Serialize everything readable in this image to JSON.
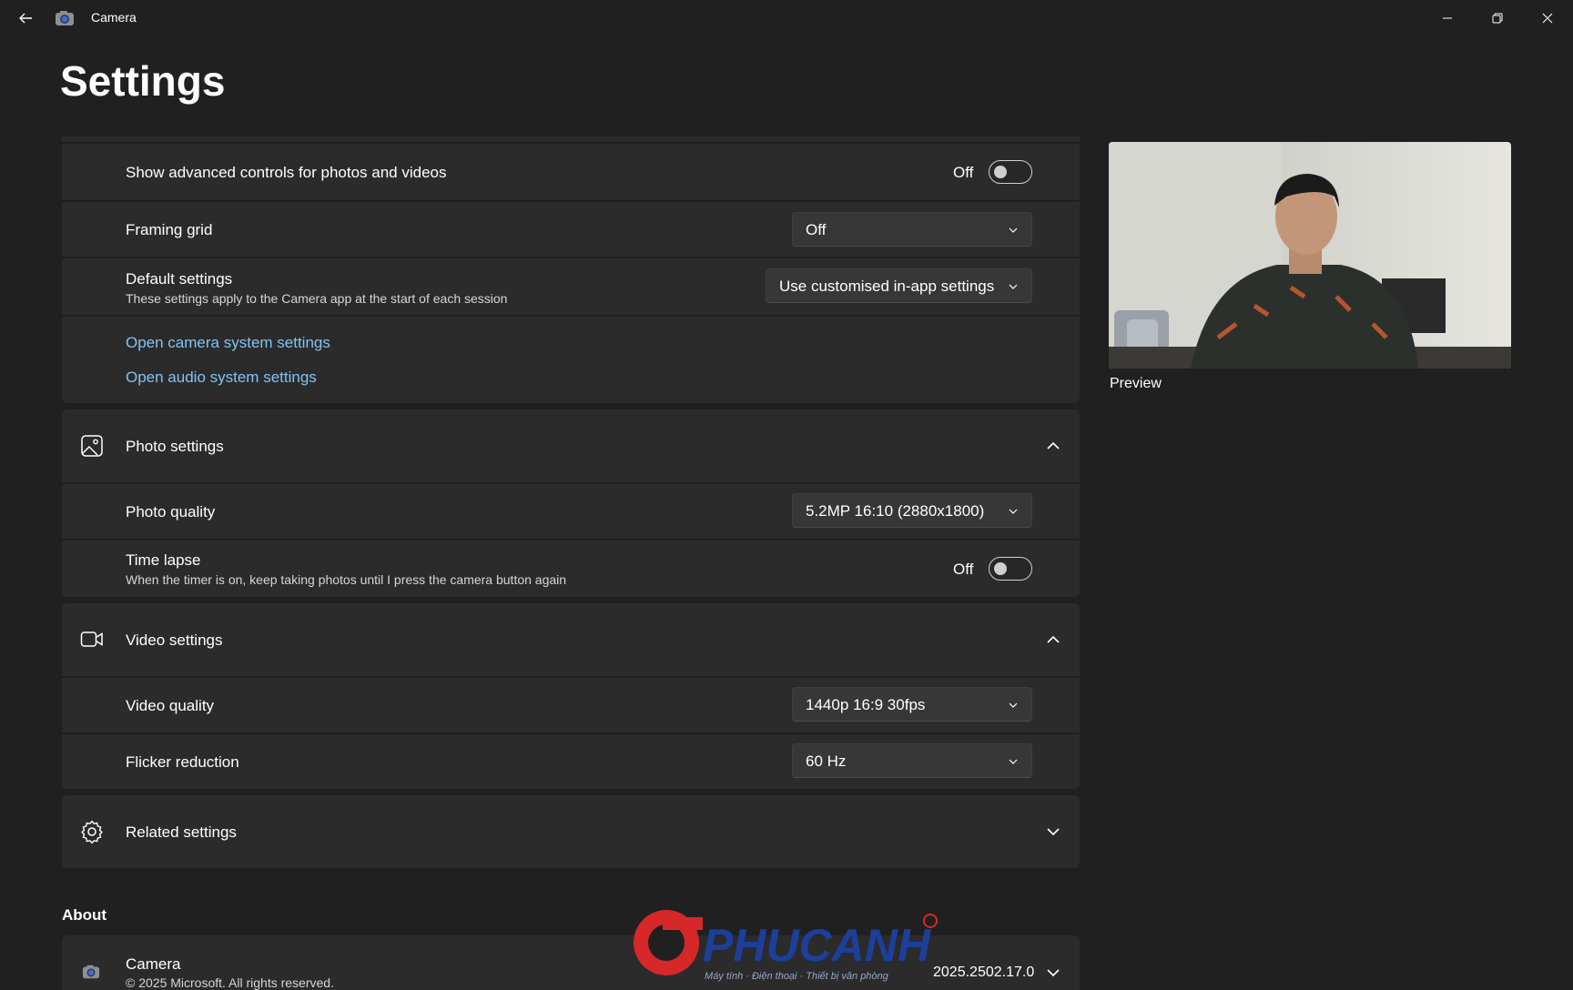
{
  "window": {
    "title": "Camera"
  },
  "page": {
    "title": "Settings"
  },
  "general": {
    "advanced_controls": {
      "label": "Show advanced controls for photos and videos",
      "state": "Off"
    },
    "framing_grid": {
      "label": "Framing grid",
      "value": "Off"
    },
    "default_settings": {
      "label": "Default settings",
      "description": "These settings apply to the Camera app at the start of each session",
      "value": "Use customised in-app settings"
    },
    "links": {
      "camera_system": "Open camera system settings",
      "audio_system": "Open audio system settings"
    }
  },
  "photo_settings": {
    "header": "Photo settings",
    "photo_quality": {
      "label": "Photo quality",
      "value": "5.2MP 16:10 (2880x1800)"
    },
    "time_lapse": {
      "label": "Time lapse",
      "description": "When the timer is on, keep taking photos until I press the camera button again",
      "state": "Off"
    }
  },
  "video_settings": {
    "header": "Video settings",
    "video_quality": {
      "label": "Video quality",
      "value": "1440p 16:9 30fps"
    },
    "flicker_reduction": {
      "label": "Flicker reduction",
      "value": "60 Hz"
    }
  },
  "related_settings": {
    "header": "Related settings"
  },
  "about": {
    "heading": "About",
    "app_name": "Camera",
    "copyright": "© 2025 Microsoft. All rights reserved.",
    "version": "2025.2502.17.0"
  },
  "preview": {
    "label": "Preview"
  },
  "watermark": {
    "brand": "PHUCANH",
    "tagline": "Máy tính · Điện thoại · Thiết bị văn phòng"
  },
  "colors": {
    "background": "#202020",
    "card": "#2b2b2b",
    "link": "#7fc4f5",
    "accent_red": "#d62828",
    "brand_blue": "#1d3f9c"
  }
}
